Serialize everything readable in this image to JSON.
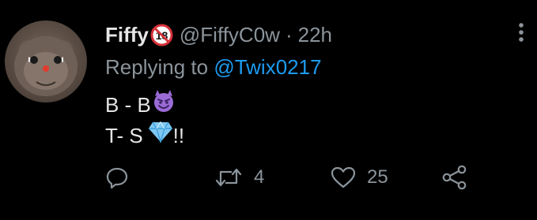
{
  "tweet": {
    "display_name": "Fiffy",
    "handle": "@FiffyC0w",
    "separator": "·",
    "timestamp": "22h",
    "replying_prefix": "Replying to",
    "replying_handle": "@Twix0217",
    "body_line_1": "B - B",
    "body_line_2_text": "T- S",
    "body_line_2_suffix": "!!",
    "icons": {
      "age_badge": "no-under-18-icon",
      "more": "more-vertical-icon",
      "body_emoji_1": "smiling-devil-emoji",
      "body_emoji_2": "gem-stone-emoji"
    },
    "actions": {
      "reply_count": "",
      "retweet_count": "4",
      "like_count": "25"
    }
  },
  "colors": {
    "background": "#000000",
    "text_primary": "#e6e6e6",
    "text_secondary": "#8b949b",
    "link": "#1d9bf0"
  }
}
